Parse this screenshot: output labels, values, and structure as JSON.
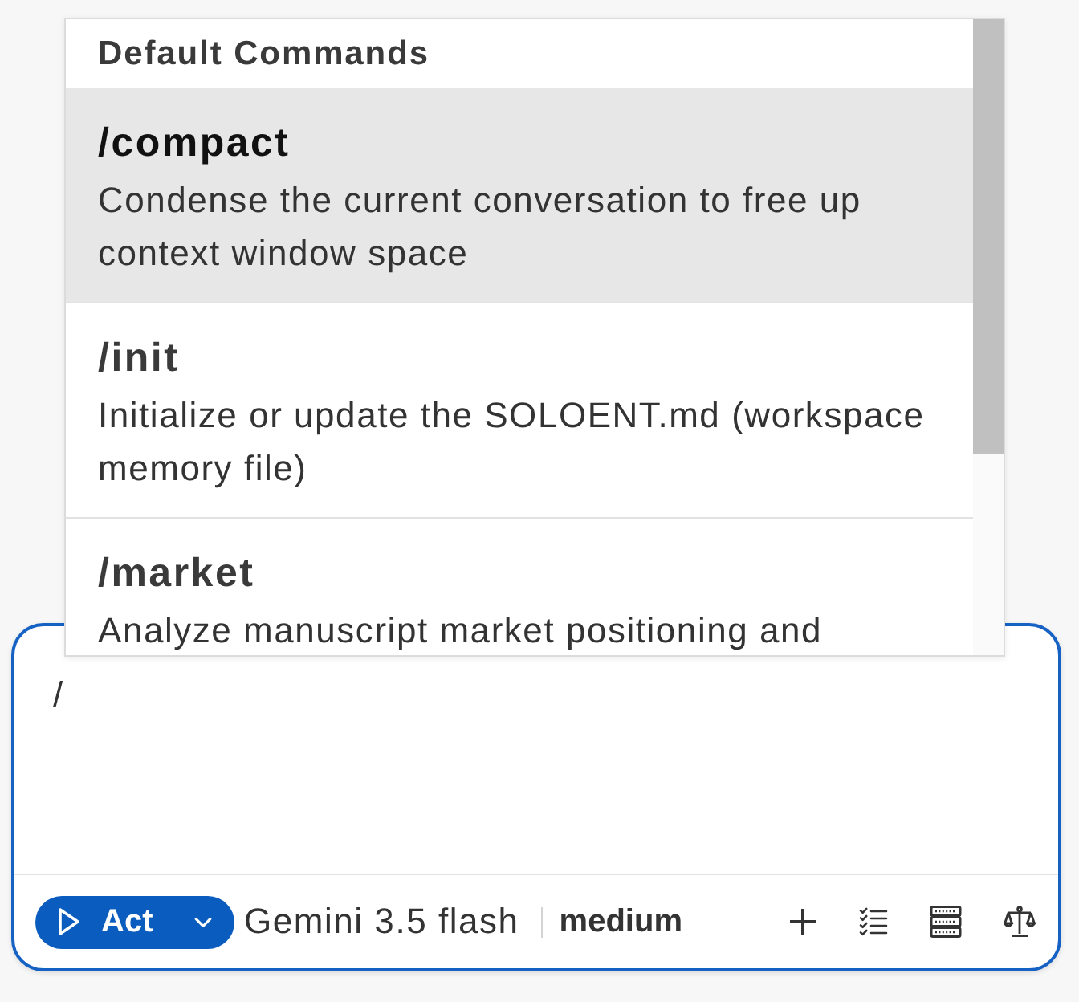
{
  "popup": {
    "heading": "Default Commands",
    "commands": [
      {
        "name": "/compact",
        "description": "Condense the current conversation to free up context window space",
        "selected": true
      },
      {
        "name": "/init",
        "description": "Initialize or update the SOLOENT.md (workspace memory file)",
        "selected": false
      },
      {
        "name": "/market",
        "description": "Analyze manuscript market positioning and",
        "selected": false
      }
    ]
  },
  "composer": {
    "value": "/",
    "mode_button": "Act",
    "model": "Gemini 3.5 flash",
    "reasoning": "medium"
  }
}
